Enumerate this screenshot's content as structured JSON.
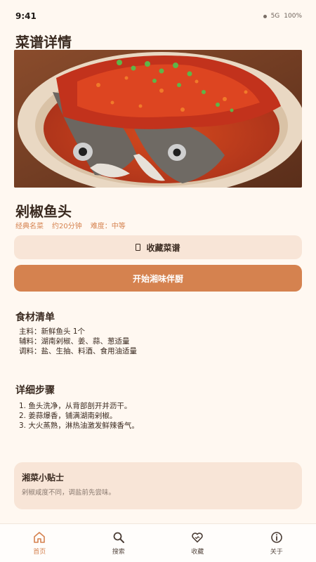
{
  "status": {
    "time": "9:41",
    "network": "5G",
    "battery": "100%"
  },
  "page": {
    "title": "菜谱详情"
  },
  "recipe": {
    "name": "剁椒鱼头",
    "category": "经典名菜",
    "duration": "约20分钟",
    "difficulty": "难度：中等"
  },
  "actions": {
    "favorite_label": "收藏菜谱",
    "start_label": "开始湘味伴厨"
  },
  "ingredients": {
    "title": "食材清单",
    "lines": [
      "主料：新鲜鱼头 1个",
      "辅料：湖南剁椒、姜、蒜、葱适量",
      "调料：盐、生抽、料酒、食用油适量"
    ]
  },
  "steps": {
    "title": "详细步骤",
    "lines": [
      "1. 鱼头洗净，从背部剖开并沥干。",
      "2. 姜蒜爆香，铺满湖南剁椒。",
      "3. 大火蒸熟，淋热油激发鲜辣香气。"
    ]
  },
  "tip": {
    "title": "湘菜小贴士",
    "text": "剁椒咸度不同，调盐前先尝味。"
  },
  "tabbar": {
    "items": [
      {
        "label": "首页",
        "icon": "home-icon",
        "active": true
      },
      {
        "label": "搜索",
        "icon": "search-icon",
        "active": false
      },
      {
        "label": "收藏",
        "icon": "heart-icon",
        "active": false
      },
      {
        "label": "关于",
        "icon": "info-icon",
        "active": false
      }
    ]
  },
  "colors": {
    "accent": "#D5824F",
    "background": "#FFF8F1",
    "card": "#F8E5D7",
    "text": "#3A2A20"
  }
}
